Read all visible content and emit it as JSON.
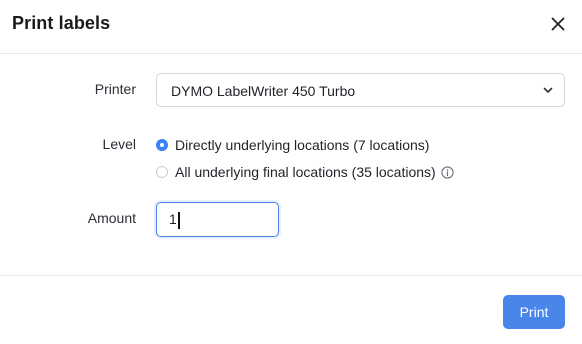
{
  "dialog": {
    "title": "Print labels",
    "close_icon": "close-icon"
  },
  "form": {
    "printer": {
      "label": "Printer",
      "selected": "DYMO LabelWriter 450 Turbo",
      "icon": "chevron-down-icon"
    },
    "level": {
      "label": "Level",
      "options": [
        {
          "label": "Directly underlying locations (7 locations)",
          "checked": true
        },
        {
          "label": "All underlying final locations (35 locations)",
          "checked": false,
          "icon": "info-icon"
        }
      ]
    },
    "amount": {
      "label": "Amount",
      "value": "1"
    }
  },
  "footer": {
    "print_label": "Print"
  },
  "colors": {
    "accent": "#3b82f6",
    "button": "#4a85ea",
    "border": "#d0d5dd"
  }
}
